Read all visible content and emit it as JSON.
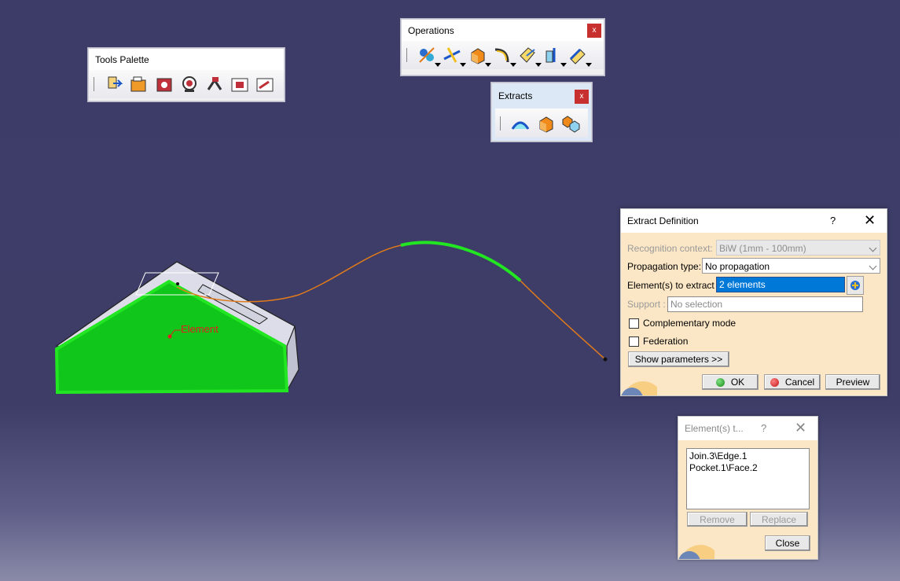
{
  "viewport": {
    "annotation_label": "Element",
    "colors": {
      "background": "#3d3c68",
      "highlight": "#22e622",
      "curve": "#e07a1a",
      "annotation": "#e02020"
    }
  },
  "tools_palette": {
    "title": "Tools Palette",
    "icons": [
      "scan-or-define-in-work-object-icon",
      "open-catalog-icon",
      "create-datum-icon",
      "insert-in-new-body-icon",
      "split-tool-icon",
      "work-on-support-icon",
      "snap-to-point-icon"
    ]
  },
  "operations": {
    "title": "Operations",
    "close_label": "x",
    "icons": [
      "join-healing-icon",
      "trim-split-icon",
      "extract-icon",
      "fillet-icon",
      "transformation-icon",
      "extrapolate-icon",
      "boundary-icon"
    ]
  },
  "extracts": {
    "title": "Extracts",
    "close_label": "x",
    "icons": [
      "boundary-icon",
      "extract-icon",
      "multiple-extract-icon"
    ]
  },
  "extract_definition": {
    "title": "Extract Definition",
    "help_label": "?",
    "close_label": "✕",
    "recognition_context_label": "Recognition context:",
    "recognition_context_value": "BiW (1mm - 100mm)",
    "propagation_type_label": "Propagation type:",
    "propagation_type_value": "No propagation",
    "elements_label": "Element(s) to extract",
    "elements_value": "2 elements",
    "support_label": "Support :",
    "support_value": "No selection",
    "complementary_mode_label": "Complementary mode",
    "federation_label": "Federation",
    "show_parameters_label": "Show parameters >>",
    "ok_label": "OK",
    "cancel_label": "Cancel",
    "preview_label": "Preview"
  },
  "elements_dialog": {
    "title": "Element(s) t...",
    "help_label": "?",
    "close_label": "✕",
    "items": [
      "Join.3\\Edge.1",
      "Pocket.1\\Face.2"
    ],
    "remove_label": "Remove",
    "replace_label": "Replace",
    "close_button_label": "Close"
  }
}
